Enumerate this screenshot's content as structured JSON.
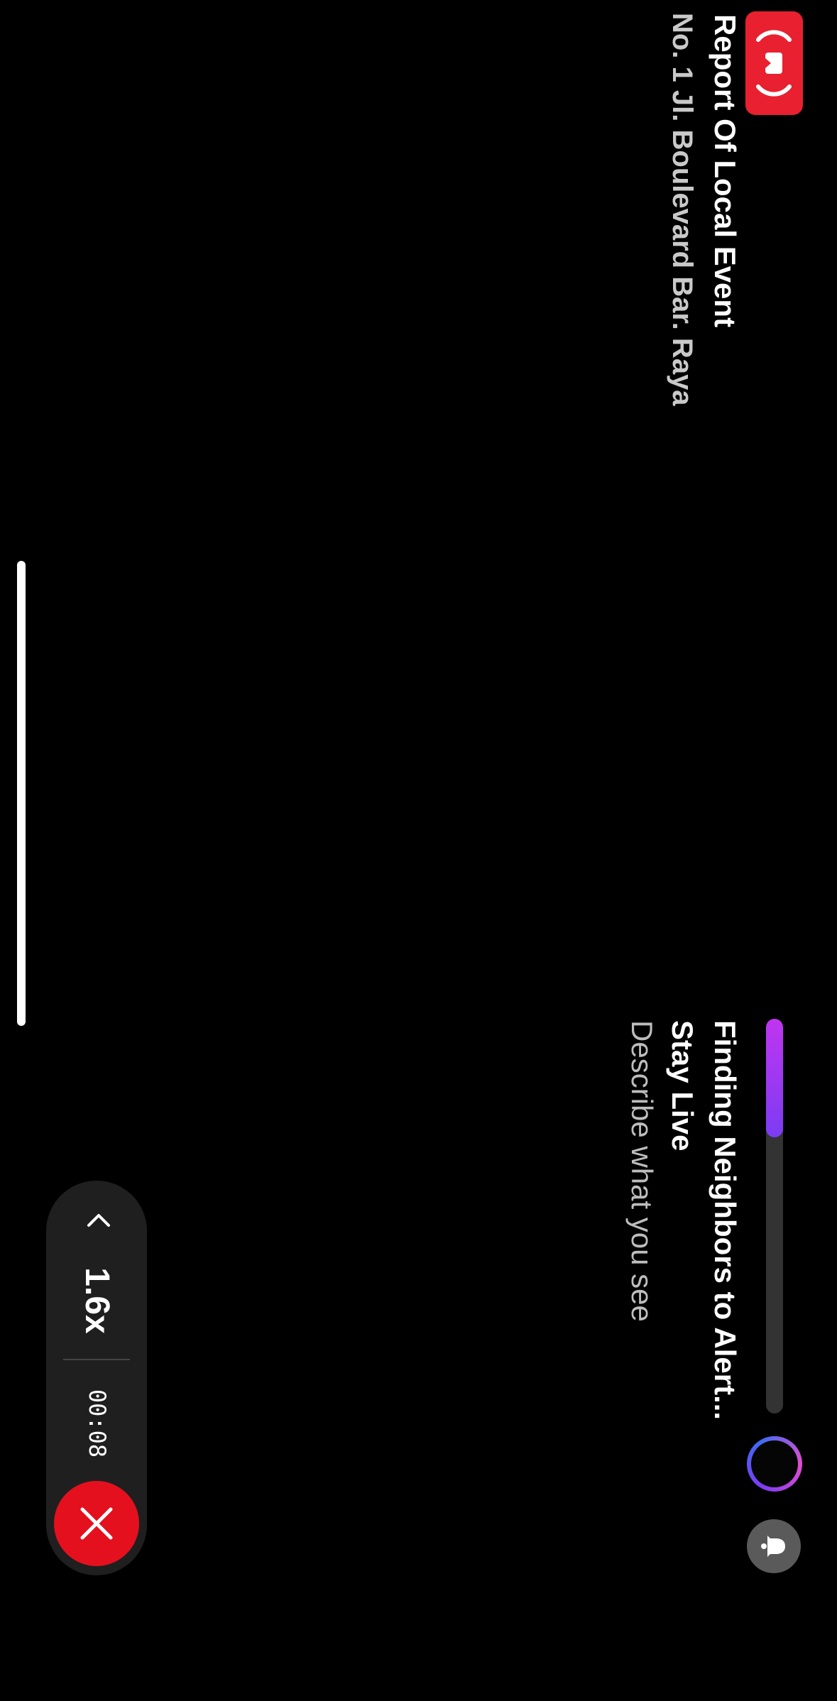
{
  "event": {
    "title": "Report Of Local Event",
    "address": "No. 1 Jl. Boulevard Bar. Raya"
  },
  "status": {
    "heading": "Finding Neighbors to Alert...",
    "mode": "Stay Live",
    "prompt": "Describe what you see",
    "progress_fraction": 0.3
  },
  "controls": {
    "zoom": "1.6x",
    "timer": "00:08"
  },
  "icons": {
    "live_badge": "live-broadcast-icon",
    "ring": "gradient-ring-icon",
    "bell": "bell-icon",
    "chevron": "chevron-up-icon",
    "stop": "close-icon"
  },
  "colors": {
    "accent_red": "#e8202f",
    "progress_purple": "#7c3cf2",
    "progress_magenta": "#c035f0",
    "pill": "#1f1f1f"
  }
}
